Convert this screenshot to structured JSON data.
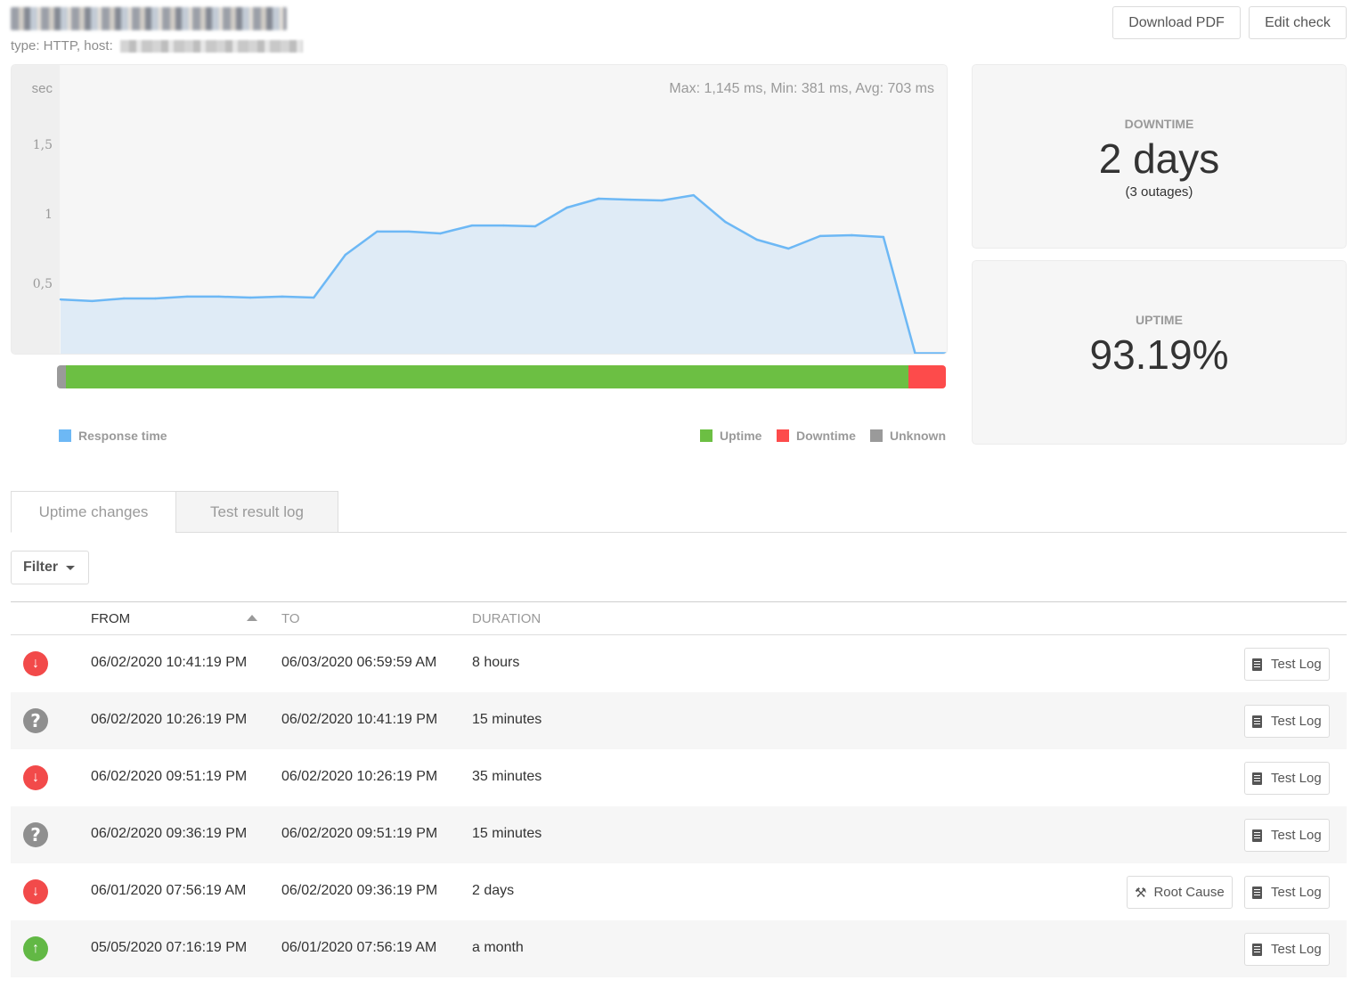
{
  "header": {
    "title_redacted": true,
    "subtitle_prefix": "type: HTTP, host:",
    "buttons": {
      "download_pdf": "Download PDF",
      "edit_check": "Edit check"
    }
  },
  "chart": {
    "stats_text": "Max: 1,145 ms, Min: 381 ms, Avg: 703 ms",
    "y_unit": "sec",
    "legend": {
      "response_time": "Response time",
      "uptime": "Uptime",
      "downtime": "Downtime",
      "unknown": "Unknown"
    },
    "colors": {
      "line": "#6db8f5",
      "fill": "#dfebf6",
      "uptime": "#6cbf43",
      "downtime": "#fd4b4b",
      "unknown": "#9a9a9a"
    }
  },
  "chart_data": {
    "type": "area",
    "title": "",
    "xlabel": "",
    "ylabel": "sec",
    "ylim": [
      0,
      1.75
    ],
    "y_ticks": [
      0.5,
      1,
      1.5
    ],
    "y_tick_labels": [
      "0,5",
      "1",
      "1,5"
    ],
    "grid": false,
    "legend_position": "bottom",
    "series": [
      {
        "name": "Response time",
        "values": [
          0.397,
          0.385,
          0.404,
          0.404,
          0.417,
          0.417,
          0.41,
          0.417,
          0.41,
          0.718,
          0.885,
          0.885,
          0.872,
          0.929,
          0.929,
          0.923,
          1.058,
          1.122,
          1.115,
          1.109,
          1.147,
          0.955,
          0.827,
          0.763,
          0.853,
          0.859,
          0.846,
          0,
          0
        ]
      }
    ],
    "status_bar": [
      {
        "name": "Unknown",
        "fraction": 0.01
      },
      {
        "name": "Uptime",
        "fraction": 0.948
      },
      {
        "name": "Downtime",
        "fraction": 0.042
      }
    ]
  },
  "stats": {
    "downtime": {
      "label": "DOWNTIME",
      "value": "2 days",
      "sub": "(3 outages)"
    },
    "uptime": {
      "label": "UPTIME",
      "value": "93.19%"
    }
  },
  "tabs": [
    {
      "label": "Uptime changes",
      "active": true
    },
    {
      "label": "Test result log",
      "active": false
    }
  ],
  "filter": {
    "label": "Filter"
  },
  "table": {
    "columns": {
      "from": "FROM",
      "to": "TO",
      "duration": "DURATION"
    },
    "rows": [
      {
        "status": "down",
        "from": "06/02/2020 10:41:19 PM",
        "to": "06/03/2020 06:59:59 AM",
        "duration": "8 hours",
        "test_log": "Test Log"
      },
      {
        "status": "unknown",
        "from": "06/02/2020 10:26:19 PM",
        "to": "06/02/2020 10:41:19 PM",
        "duration": "15 minutes",
        "test_log": "Test Log"
      },
      {
        "status": "down",
        "from": "06/02/2020 09:51:19 PM",
        "to": "06/02/2020 10:26:19 PM",
        "duration": "35 minutes",
        "test_log": "Test Log"
      },
      {
        "status": "unknown",
        "from": "06/02/2020 09:36:19 PM",
        "to": "06/02/2020 09:51:19 PM",
        "duration": "15 minutes",
        "test_log": "Test Log"
      },
      {
        "status": "down",
        "from": "06/01/2020 07:56:19 AM",
        "to": "06/02/2020 09:36:19 PM",
        "duration": "2 days",
        "root_cause": "Root Cause",
        "test_log": "Test Log"
      },
      {
        "status": "up",
        "from": "05/05/2020 07:16:19 PM",
        "to": "06/01/2020 07:56:19 AM",
        "duration": "a month",
        "test_log": "Test Log"
      }
    ]
  }
}
